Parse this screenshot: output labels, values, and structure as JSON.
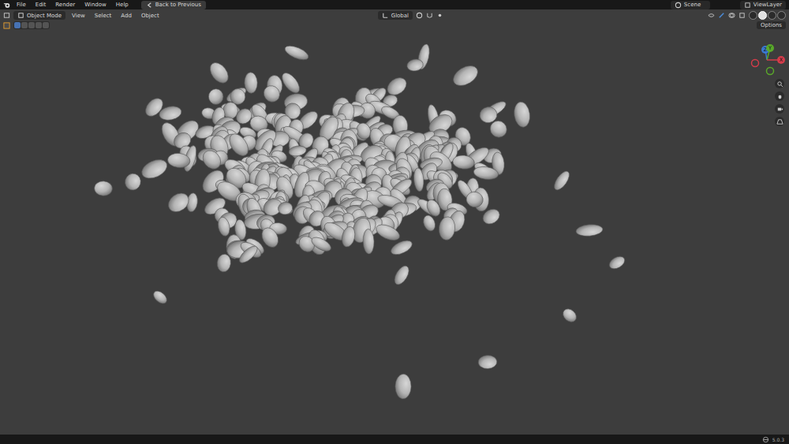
{
  "topbar": {
    "menus": [
      "File",
      "Edit",
      "Render",
      "Window",
      "Help"
    ],
    "back_button": "Back to Previous",
    "scene": "Scene",
    "view_layer": "ViewLayer"
  },
  "header": {
    "mode": "Object Mode",
    "menus": [
      "View",
      "Select",
      "Add",
      "Object"
    ],
    "transform_orientation": "Global",
    "options": "Options",
    "select_modes": [
      {
        "selected": true
      },
      {
        "selected": false
      },
      {
        "selected": false
      },
      {
        "selected": false
      },
      {
        "selected": false
      }
    ],
    "shading_modes": [
      {
        "selected": false
      },
      {
        "selected": true
      },
      {
        "selected": false
      },
      {
        "selected": false
      }
    ]
  },
  "gizmo": {
    "axes": [
      {
        "label": "X",
        "color": "#d43c4a"
      },
      {
        "label": "Y",
        "color": "#5aa82a"
      },
      {
        "label": "Z",
        "color": "#3a78d4"
      }
    ]
  },
  "status_bar": {
    "version": "5.0.3"
  }
}
